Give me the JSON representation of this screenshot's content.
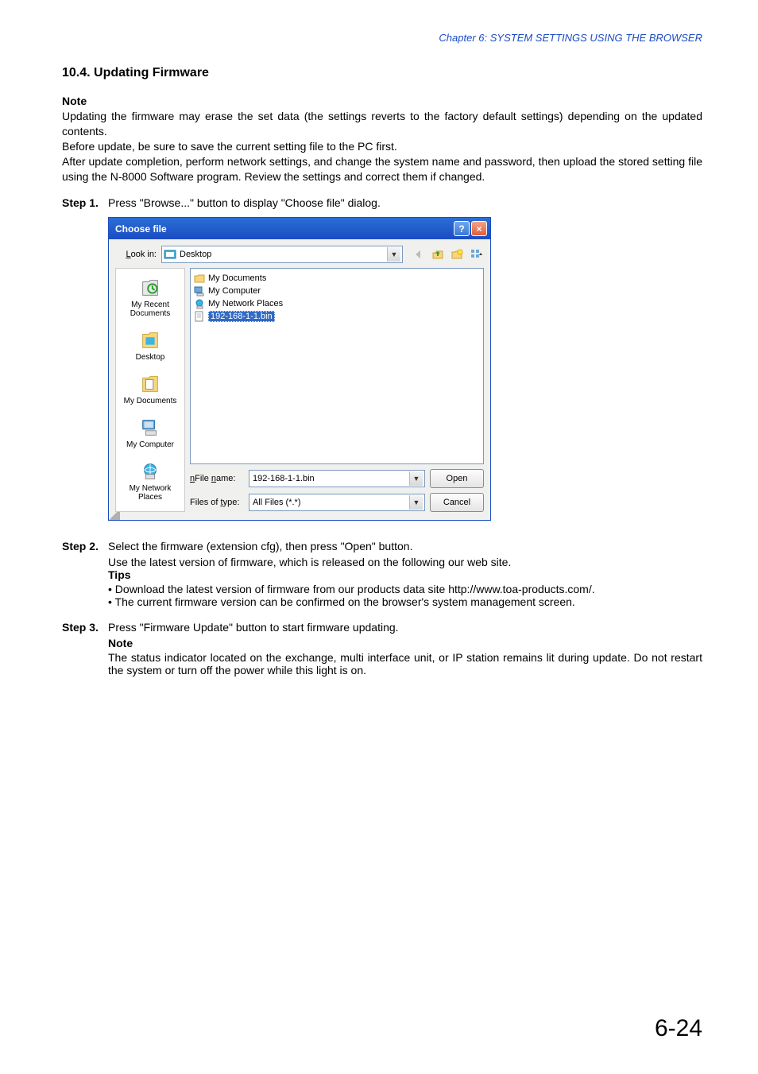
{
  "chapter_header": "Chapter 6:  SYSTEM SETTINGS USING THE BROWSER",
  "section_title": "10.4. Updating Firmware",
  "note_heading": "Note",
  "note_text": "Updating the firmware may erase the set data (the settings reverts to the factory default settings) depending on the updated contents.\nBefore update, be sure to save the current setting file to the PC first.\nAfter update completion, perform network settings, and change the system name and password, then upload the stored setting file using the N-8000 Software program. Review the settings and correct them if changed.",
  "step1_label": "Step 1.",
  "step1_text": "Press \"Browse...\" button to display \"Choose file\" dialog.",
  "step2_label": "Step 2.",
  "step2_text": "Select the firmware (extension cfg), then press \"Open\" button.",
  "step2_sub": "Use the latest version of firmware, which is released on the following our web site.",
  "tips_heading": "Tips",
  "tip1": "• Download the latest version of firmware from our products data site http://www.toa-products.com/.",
  "tip2": "• The current firmware version can be confirmed on the browser's system management screen.",
  "step3_label": "Step 3.",
  "step3_text": "Press \"Firmware Update\" button to start firmware updating.",
  "step3_note_heading": "Note",
  "step3_note": "The status indicator located on the exchange, multi interface unit, or IP station remains lit during update. Do not restart the system or turn off the power while this light is on.",
  "page_number": "6-24",
  "dialog": {
    "title": "Choose file",
    "help_label": "?",
    "close_label": "×",
    "lookin_label": "Look in:",
    "lookin_value": "Desktop",
    "back_tooltip": "Back",
    "up_tooltip": "Up",
    "new_tooltip": "New Folder",
    "views_tooltip": "Views",
    "places": {
      "recent": "My Recent Documents",
      "desktop": "Desktop",
      "mydocs": "My Documents",
      "mycomp": "My Computer",
      "mynet": "My Network Places"
    },
    "file_items": {
      "mydocs": "My Documents",
      "mycomp": "My Computer",
      "mynet": "My Network Places",
      "selected": "192-168-1-1.bin"
    },
    "filename_label": "File name:",
    "filename_value": "192-168-1-1.bin",
    "filetype_label": "Files of type:",
    "filetype_value": "All Files (*.*)",
    "open_btn": "Open",
    "cancel_btn": "Cancel"
  }
}
